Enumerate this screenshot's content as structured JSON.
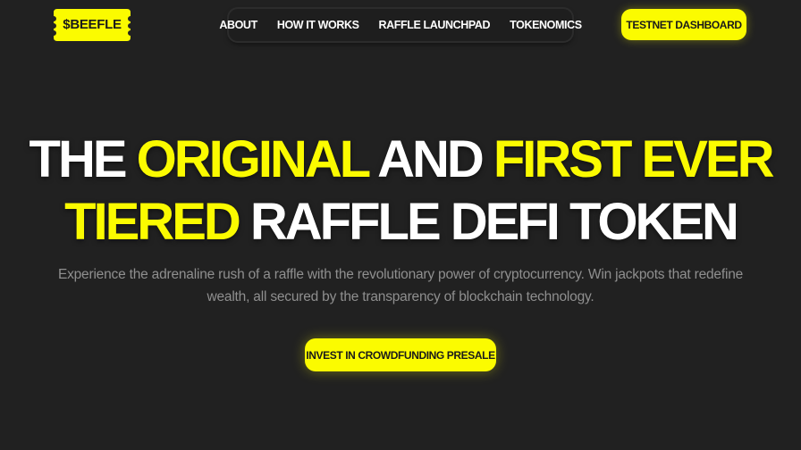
{
  "brand": {
    "logo_text": "$BEEFLE",
    "accent_color": "#fbfb00",
    "background_color": "#212121"
  },
  "nav": {
    "items": [
      {
        "label": "ABOUT"
      },
      {
        "label": "HOW IT WORKS"
      },
      {
        "label": "RAFFLE LAUNCHPAD"
      },
      {
        "label": "TOKENOMICS"
      }
    ]
  },
  "header": {
    "cta_label": "TESTNET DASHBOARD"
  },
  "hero": {
    "title": {
      "part1": "THE ",
      "highlight1": "ORIGINAL",
      "part2": " AND ",
      "highlight2": "FIRST EVER",
      "highlight3": "TIERED",
      "part3": " RAFFLE DEFI TOKEN"
    },
    "subtitle": "Experience the adrenaline rush of a raffle with the revolutionary power of cryptocurrency. Win jackpots that redefine wealth, all secured by the transparency of blockchain technology.",
    "cta_label": "INVEST IN CROWDFUNDING PRESALE"
  }
}
